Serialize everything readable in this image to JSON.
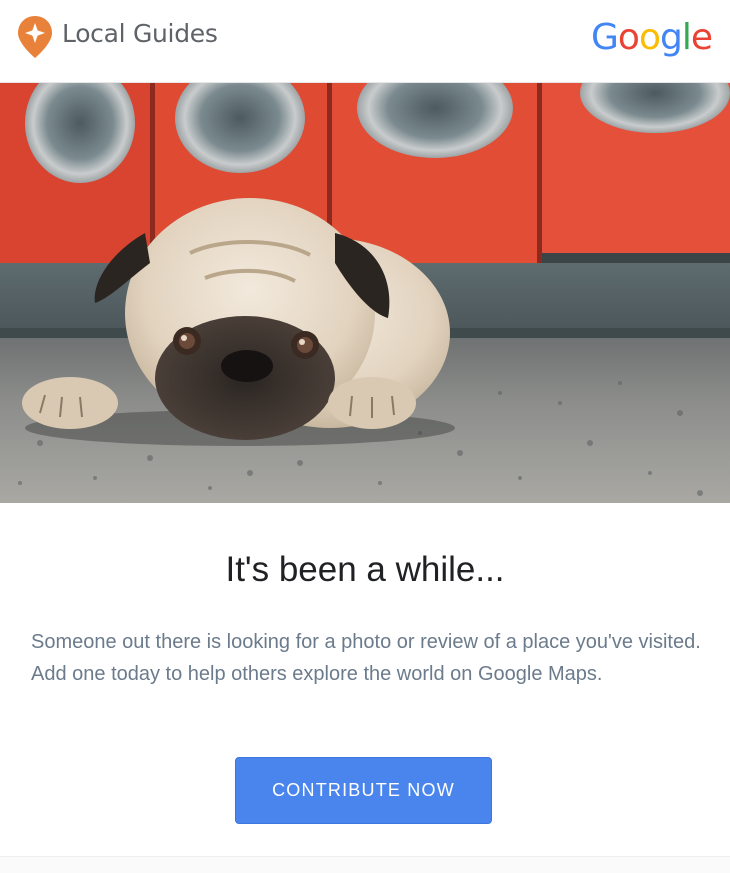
{
  "header": {
    "brand_label": "Local Guides",
    "logo_icon": "local-guides-pin-star-icon",
    "partner_logo": {
      "letters": [
        {
          "char": "G",
          "color": "#4285F4"
        },
        {
          "char": "o",
          "color": "#EA4335"
        },
        {
          "char": "o",
          "color": "#FBBC05"
        },
        {
          "char": "g",
          "color": "#4285F4"
        },
        {
          "char": "l",
          "color": "#34A853"
        },
        {
          "char": "e",
          "color": "#EA4335"
        }
      ]
    }
  },
  "hero": {
    "image_subject": "pug lying on terrazzo floor in front of red washing machines"
  },
  "content": {
    "headline": "It's been a while...",
    "body": "Someone out there is looking for a photo or review of a place you've visited. Add one today to help others explore the world on Google Maps."
  },
  "cta": {
    "label": "CONTRIBUTE NOW",
    "color": "#4A85EE"
  },
  "colors": {
    "brand_orange": "#E8823A",
    "body_text": "#6B7B8C",
    "headline_text": "#202124"
  }
}
